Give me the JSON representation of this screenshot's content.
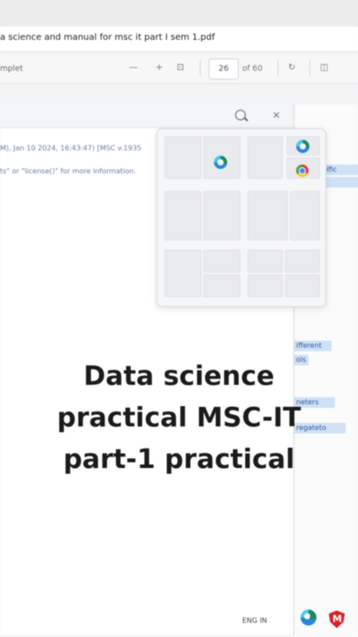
{
  "window": {
    "title": "a science and manual for msc it part I sem 1.pdf"
  },
  "toolbar": {
    "left_label": "mplet",
    "minus": "—",
    "plus": "+",
    "fit": "⊡",
    "page_current": "26",
    "page_total": "of 60",
    "rotate": "↻",
    "book": "◫"
  },
  "editor": {
    "line1": "M), Jan 10 2024, 16:43:47) [MSC v.1935",
    "line2": "ts\" or \"license()\" for more information."
  },
  "side_highlights": {
    "h1": "ecific",
    "h2": "nsific",
    "h3": "ifferent",
    "h4": "ols",
    "h5": "neters",
    "h6": "regateto"
  },
  "overlay": {
    "line1": "Data science",
    "line2": "practical MSC-IT",
    "line3": "part-1 practical"
  },
  "taskbar": {
    "text": "ENG IN"
  },
  "colors": {
    "highlight": "#cfe1f5",
    "overlay_text": "#1b1b1b",
    "antivirus_red": "#d4212a"
  }
}
